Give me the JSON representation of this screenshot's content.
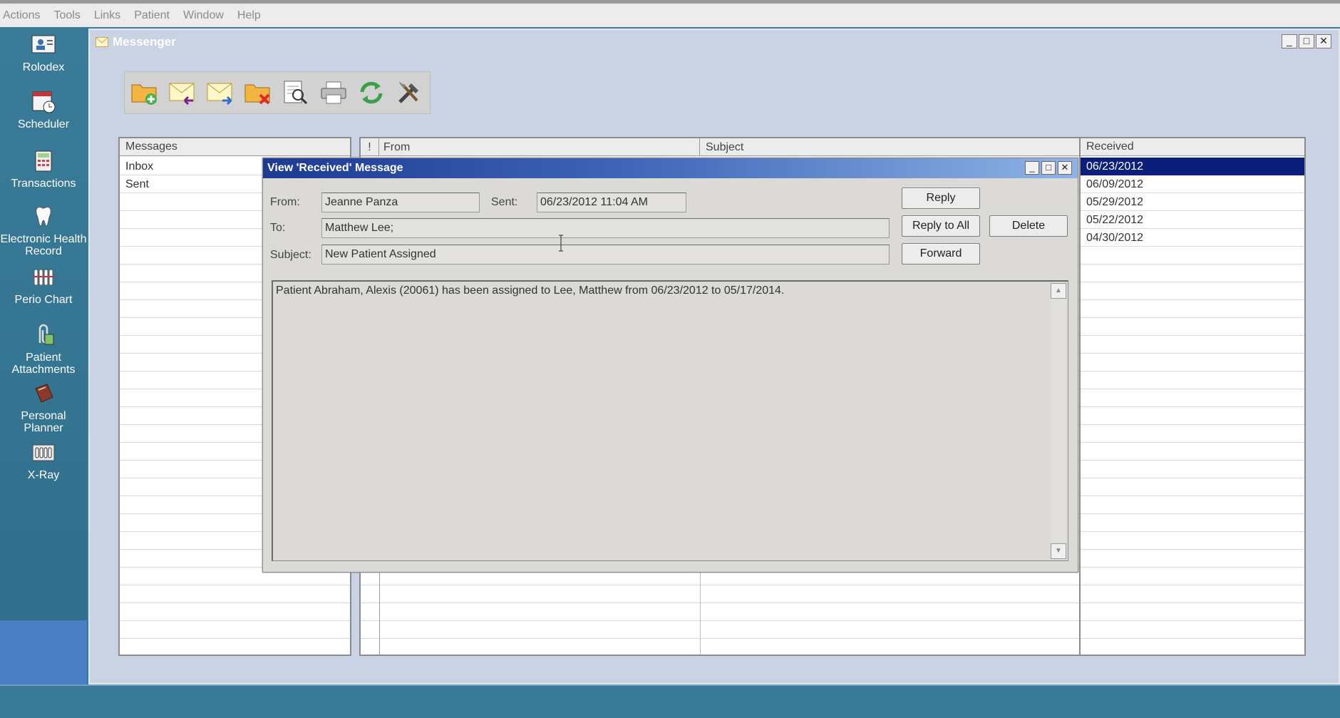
{
  "menu": [
    "Actions",
    "Tools",
    "Links",
    "Patient",
    "Window",
    "Help"
  ],
  "nav": [
    {
      "label": "Rolodex",
      "icon": "rolodex-icon"
    },
    {
      "label": "Scheduler",
      "icon": "scheduler-icon"
    },
    {
      "label": "Transactions",
      "icon": "calculator-icon"
    },
    {
      "label": "Electronic Health Record",
      "icon": "tooth-icon"
    },
    {
      "label": "Perio Chart",
      "icon": "perio-chart-icon"
    },
    {
      "label": "Patient Attachments",
      "icon": "paperclip-icon"
    },
    {
      "label": "Personal Planner",
      "icon": "planner-book-icon"
    },
    {
      "label": "X-Ray",
      "icon": "xray-icon"
    }
  ],
  "messenger": {
    "title": "Messenger",
    "toolbar": [
      "new-folder-icon",
      "receive-mail-icon",
      "send-mail-icon",
      "delete-folder-icon",
      "preview-icon",
      "print-icon",
      "refresh-icon",
      "tools-icon"
    ]
  },
  "folders": {
    "header": "Messages",
    "items": [
      "Inbox",
      "Sent"
    ]
  },
  "message_list": {
    "headers": {
      "flag": "!",
      "from": "From",
      "subject": "Subject",
      "received": "Received"
    },
    "received_dates": [
      "06/23/2012",
      "06/09/2012",
      "05/29/2012",
      "05/22/2012",
      "04/30/2012"
    ]
  },
  "dialog": {
    "title": "View 'Received' Message",
    "from_label": "From:",
    "from_value": "Jeanne Panza",
    "sent_label": "Sent:",
    "sent_value": "06/23/2012  11:04 AM",
    "to_label": "To:",
    "to_value": "Matthew Lee;",
    "subject_label": "Subject:",
    "subject_value": "New Patient Assigned",
    "buttons": {
      "reply": "Reply",
      "reply_all": "Reply to All",
      "delete": "Delete",
      "forward": "Forward"
    },
    "body": "Patient Abraham, Alexis (20061) has been assigned to Lee, Matthew from 06/23/2012 to 05/17/2014."
  },
  "colors": {
    "nav_bg": "#3a7c98",
    "selected_row": "#0b1e7a",
    "dialog_title": "#1d3a92"
  }
}
